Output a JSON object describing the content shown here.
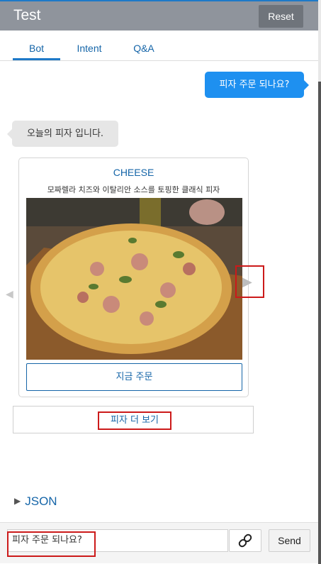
{
  "header": {
    "title": "Test",
    "reset_label": "Reset"
  },
  "tabs": [
    {
      "label": "Bot",
      "active": true
    },
    {
      "label": "Intent",
      "active": false
    },
    {
      "label": "Q&A",
      "active": false
    }
  ],
  "chat": {
    "user_message": "피자 주문 되나요?",
    "bot_message": "오늘의 피자 입니다.",
    "card": {
      "title": "CHEESE",
      "subtitle": "모짜렐라 치즈와 이탈리안 소스를 토핑한 클래식 피자",
      "image_icon": "pizza-photo",
      "button_label": "지금 주문"
    },
    "more_label": "피자 더 보기",
    "carousel": {
      "prev_icon": "chevron-left-icon",
      "next_icon": "chevron-right-icon"
    }
  },
  "json_toggle": {
    "label": "JSON"
  },
  "footer": {
    "input_value": "피자 주문 되나요?",
    "link_icon": "link-icon",
    "send_label": "Send"
  },
  "colors": {
    "accent": "#1e79c8",
    "user_bubble": "#1e90f0",
    "bot_bubble": "#e6e6e6",
    "header_bg": "#8f949c",
    "highlight": "#cc1a1a"
  }
}
